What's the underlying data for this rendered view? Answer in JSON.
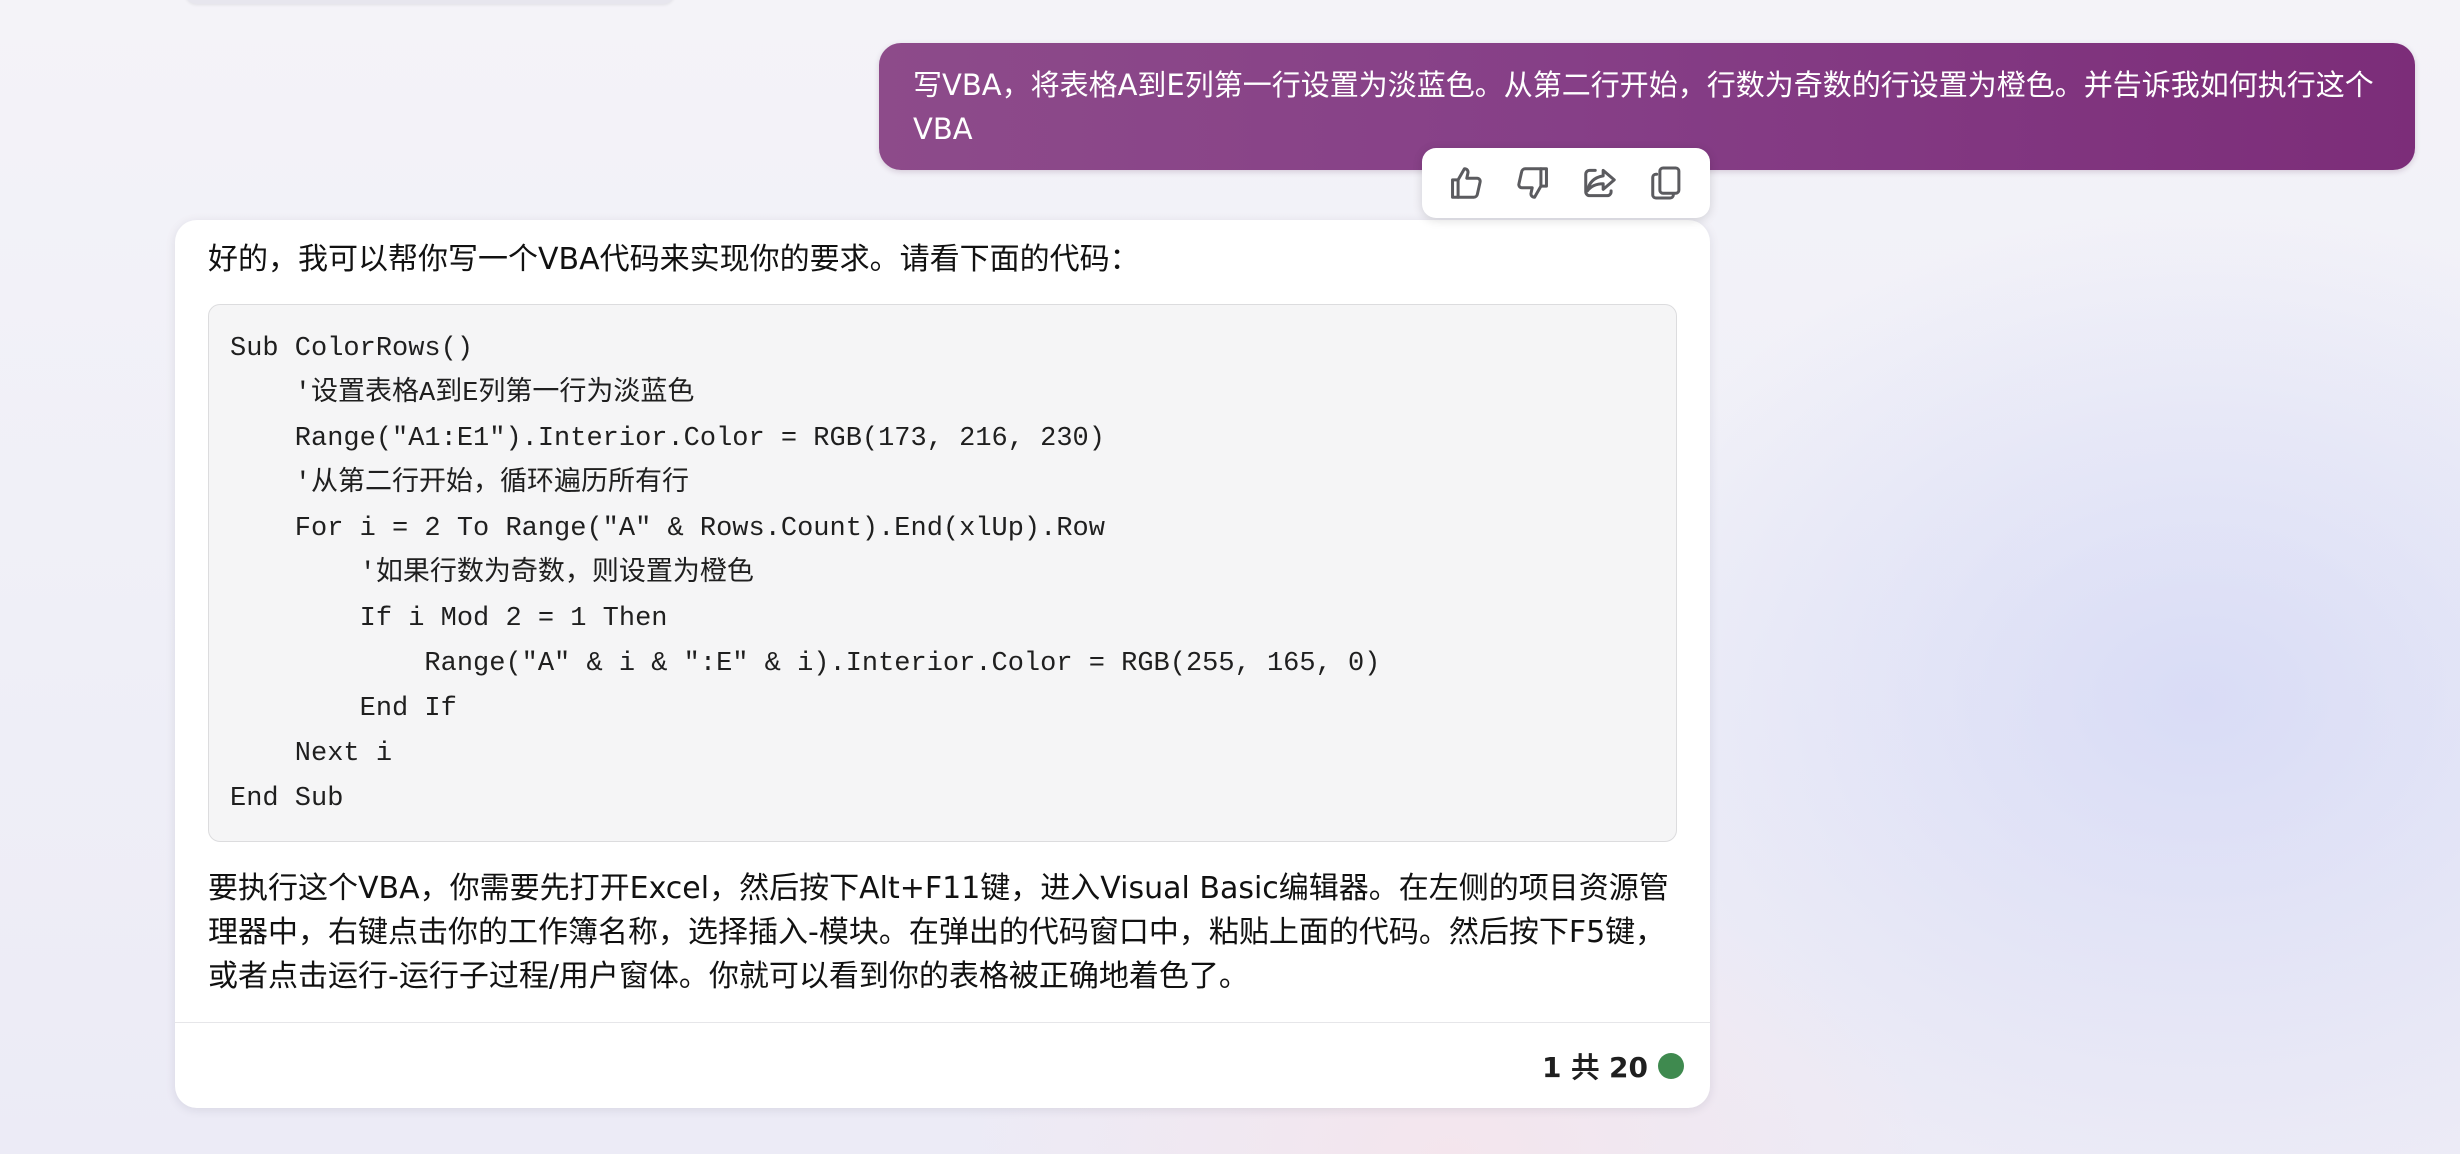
{
  "user_message": {
    "text": "写VBA，将表格A到E列第一行设置为淡蓝色。从第二行开始，行数为奇数的行设置为橙色。并告诉我如何执行这个VBA"
  },
  "actions": {
    "like_icon": "thumbs-up-icon",
    "dislike_icon": "thumbs-down-icon",
    "share_icon": "share-icon",
    "copy_icon": "copy-icon"
  },
  "response": {
    "intro": "好的，我可以帮你写一个VBA代码来实现你的要求。请看下面的代码：",
    "code_lines": [
      "Sub ColorRows()",
      "    '设置表格A到E列第一行为淡蓝色",
      "    Range(\"A1:E1\").Interior.Color = RGB(173, 216, 230)",
      "    '从第二行开始，循环遍历所有行",
      "    For i = 2 To Range(\"A\" & Rows.Count).End(xlUp).Row",
      "        '如果行数为奇数，则设置为橙色",
      "        If i Mod 2 = 1 Then",
      "            Range(\"A\" & i & \":E\" & i).Interior.Color = RGB(255, 165, 0)",
      "        End If",
      "    Next i",
      "End Sub"
    ],
    "outro": "要执行这个VBA，你需要先打开Excel，然后按下Alt+F11键，进入Visual Basic编辑器。在左侧的项目资源管理器中，右键点击你的工作簿名称，选择插入-模块。在弹出的代码窗口中，粘贴上面的代码。然后按下F5键，或者点击运行-运行子过程/用户窗体。你就可以看到你的表格被正确地着色了。",
    "counter": "1 共 20"
  },
  "colors": {
    "user_bubble": "#863f87",
    "status_dot": "#3f8a4f"
  }
}
